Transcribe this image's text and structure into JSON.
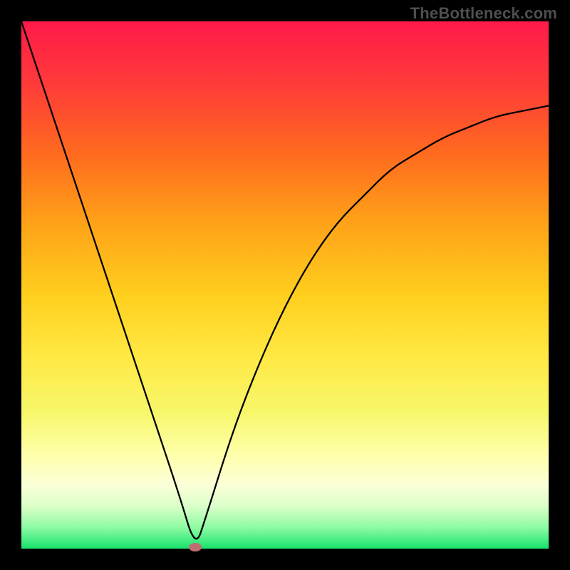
{
  "watermark": "TheBottleneck.com",
  "chart_data": {
    "type": "line",
    "title": "",
    "xlabel": "",
    "ylabel": "",
    "xlim": [
      0,
      100
    ],
    "ylim": [
      0,
      100
    ],
    "series": [
      {
        "name": "bottleneck-curve",
        "x": [
          0,
          5,
          10,
          15,
          20,
          25,
          30,
          33,
          35,
          40,
          45,
          50,
          55,
          60,
          65,
          70,
          75,
          80,
          85,
          90,
          95,
          100
        ],
        "y": [
          100,
          85,
          70,
          55,
          40,
          25,
          10,
          0,
          6,
          22,
          35,
          46,
          55,
          62,
          67,
          72,
          75,
          78,
          80,
          82,
          83,
          84
        ]
      }
    ],
    "marker": {
      "x": 33,
      "y": 0,
      "color": "#c26d73"
    },
    "background_gradient": {
      "top": "#ff1a4a",
      "mid": "#ffe945",
      "bottom": "#17e26c"
    }
  }
}
